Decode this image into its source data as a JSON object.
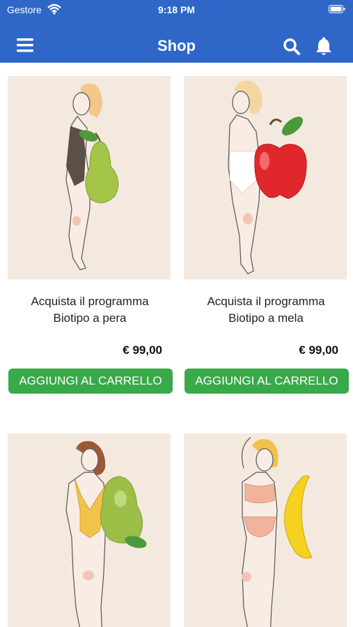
{
  "status_bar": {
    "carrier": "Gestore",
    "time": "9:18 PM"
  },
  "header": {
    "title": "Shop"
  },
  "products": [
    {
      "name_line1": "Acquista il programma",
      "name_line2": "Biotipo a pera",
      "price": "€ 99,00",
      "button": "AGGIUNGI AL CARRELLO",
      "fruit": "pear-icon"
    },
    {
      "name_line1": "Acquista il programma",
      "name_line2": "Biotipo a mela",
      "price": "€ 99,00",
      "button": "AGGIUNGI AL CARRELLO",
      "fruit": "apple-icon"
    },
    {
      "fruit": "pear-icon"
    },
    {
      "fruit": "banana-icon"
    }
  ],
  "colors": {
    "header": "#2f67c8",
    "button": "#39a94a",
    "image_bg": "#f4e9df"
  }
}
